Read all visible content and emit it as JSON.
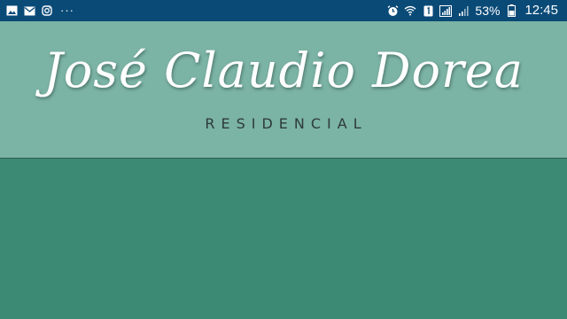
{
  "status_bar": {
    "notification_icons": [
      "image-icon",
      "mail-icon",
      "instagram-icon"
    ],
    "more_indicator": "···",
    "system_icons": [
      "alarm-icon",
      "wifi-icon",
      "sim1-icon",
      "signal-icon",
      "signal-icon",
      "battery-icon"
    ],
    "battery_percent": "53%",
    "time": "12:45",
    "background": "#0a4a77"
  },
  "header": {
    "title": "José Claudio Dorea",
    "subtitle": "RESIDENCIAL",
    "background": "#7bb3a5"
  },
  "content": {
    "background": "#3c8a73"
  }
}
